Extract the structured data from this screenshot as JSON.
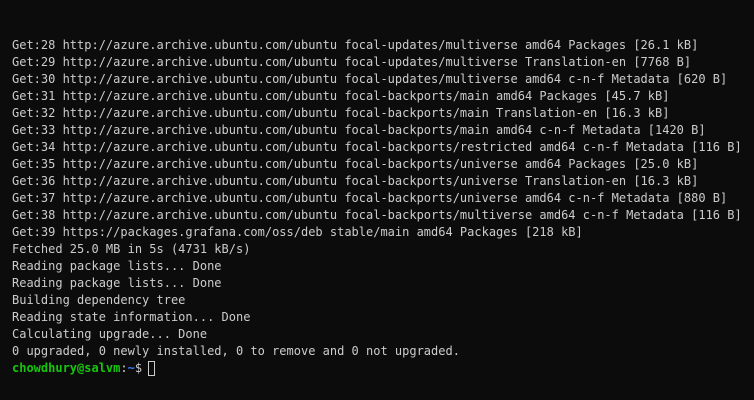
{
  "terminal": {
    "lines": [
      "Get:28 http://azure.archive.ubuntu.com/ubuntu focal-updates/multiverse amd64 Packages [26.1 kB]",
      "Get:29 http://azure.archive.ubuntu.com/ubuntu focal-updates/multiverse Translation-en [7768 B]",
      "Get:30 http://azure.archive.ubuntu.com/ubuntu focal-updates/multiverse amd64 c-n-f Metadata [620 B]",
      "Get:31 http://azure.archive.ubuntu.com/ubuntu focal-backports/main amd64 Packages [45.7 kB]",
      "Get:32 http://azure.archive.ubuntu.com/ubuntu focal-backports/main Translation-en [16.3 kB]",
      "Get:33 http://azure.archive.ubuntu.com/ubuntu focal-backports/main amd64 c-n-f Metadata [1420 B]",
      "Get:34 http://azure.archive.ubuntu.com/ubuntu focal-backports/restricted amd64 c-n-f Metadata [116 B]",
      "Get:35 http://azure.archive.ubuntu.com/ubuntu focal-backports/universe amd64 Packages [25.0 kB]",
      "Get:36 http://azure.archive.ubuntu.com/ubuntu focal-backports/universe Translation-en [16.3 kB]",
      "Get:37 http://azure.archive.ubuntu.com/ubuntu focal-backports/universe amd64 c-n-f Metadata [880 B]",
      "Get:38 http://azure.archive.ubuntu.com/ubuntu focal-backports/multiverse amd64 c-n-f Metadata [116 B]",
      "Get:39 https://packages.grafana.com/oss/deb stable/main amd64 Packages [218 kB]",
      "Fetched 25.0 MB in 5s (4731 kB/s)",
      "Reading package lists... Done",
      "Reading package lists... Done",
      "Building dependency tree",
      "Reading state information... Done",
      "Calculating upgrade... Done",
      "0 upgraded, 0 newly installed, 0 to remove and 0 not upgraded."
    ],
    "prompt": {
      "user_host": "chowdhury@salvm",
      "separator": ":",
      "path": "~",
      "symbol": "$"
    },
    "colors": {
      "background": "#0c0c0c",
      "text": "#cccccc",
      "user_host": "#16c60c",
      "path": "#3b78ff"
    }
  }
}
